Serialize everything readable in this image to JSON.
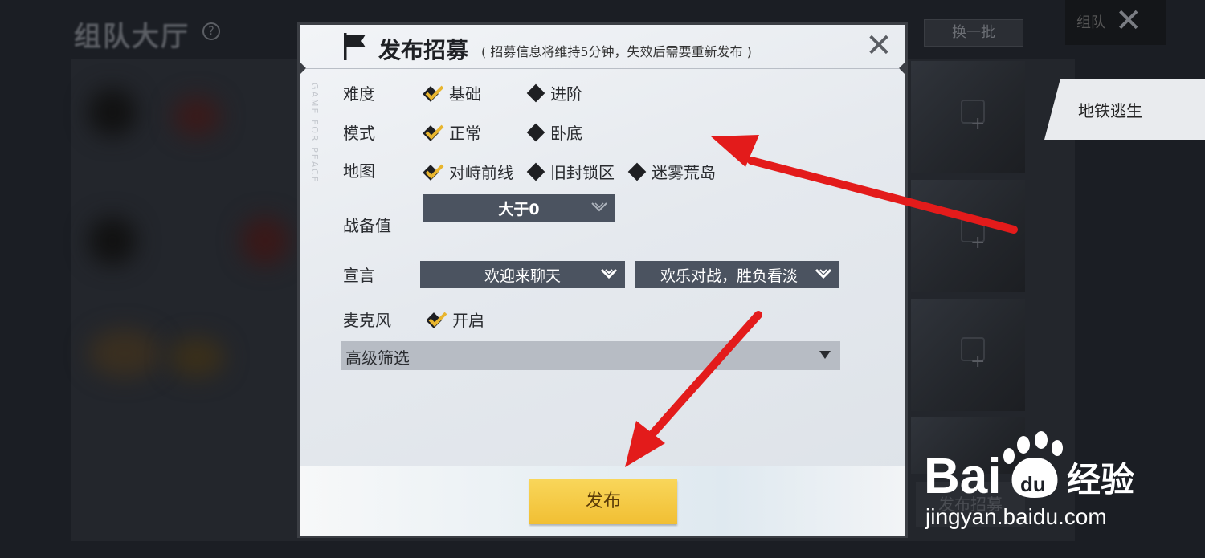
{
  "background": {
    "title": "组队大厅",
    "help_icon": "question-icon",
    "refresh_label": "换一批",
    "top_label": "组队",
    "metro_tab_label": "地铁逃生",
    "bg_publish_label": "发布招募"
  },
  "modal": {
    "title": "发布招募",
    "subtitle": "( 招募信息将维持5分钟，失效后需要重新发布 )",
    "side_text": "GAME FOR PEACE",
    "rows": {
      "difficulty": {
        "label": "难度",
        "options": [
          {
            "label": "基础",
            "selected": true
          },
          {
            "label": "进阶",
            "selected": false
          }
        ]
      },
      "mode": {
        "label": "模式",
        "options": [
          {
            "label": "正常",
            "selected": true
          },
          {
            "label": "卧底",
            "selected": false
          }
        ]
      },
      "map": {
        "label": "地图",
        "options": [
          {
            "label": "对峙前线",
            "selected": true
          },
          {
            "label": "旧封锁区",
            "selected": false
          },
          {
            "label": "迷雾荒岛",
            "selected": false
          }
        ]
      },
      "battle_value": {
        "label": "战备值",
        "value": "大于0"
      },
      "declaration": {
        "label": "宣言",
        "value1": "欢迎来聊天",
        "value2": "欢乐对战，胜负看淡"
      },
      "microphone": {
        "label": "麦克风",
        "option": "开启",
        "selected": true
      }
    },
    "advanced_filter": "高级筛选",
    "publish_label": "发布"
  },
  "colors": {
    "accent_yellow": "#f1bf33",
    "dropdown_bg": "#4b5360",
    "arrow_red": "#e31b1b"
  },
  "watermark": {
    "brand": "Bai",
    "brand_paw": "du",
    "brand_cn": "经验",
    "url": "jingyan.baidu.com"
  }
}
